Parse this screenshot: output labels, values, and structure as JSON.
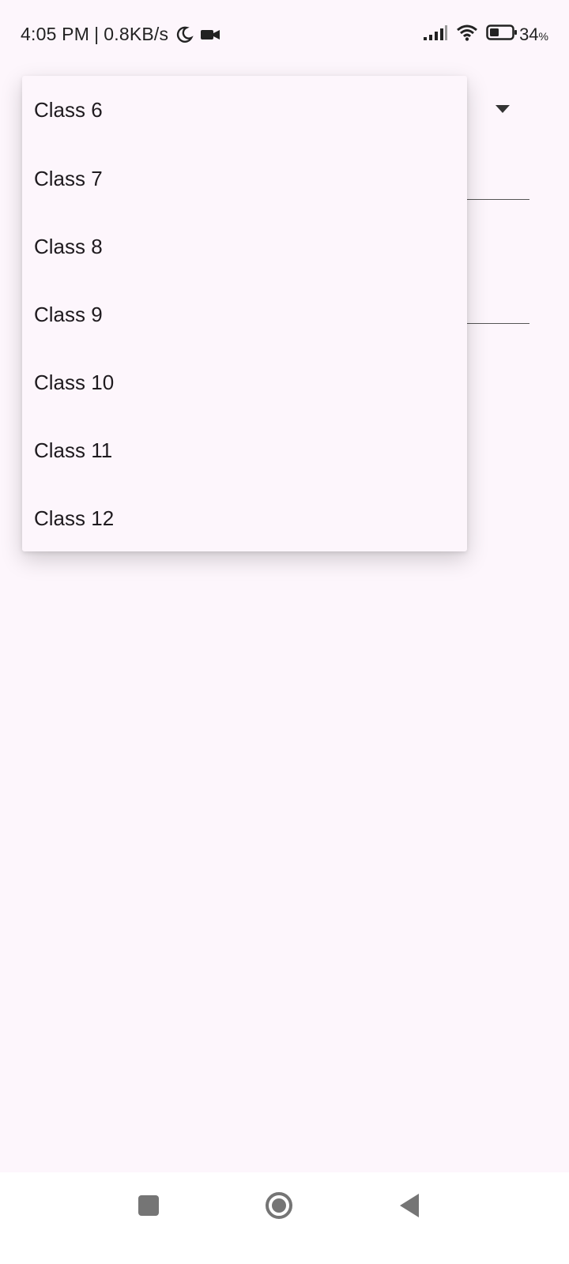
{
  "status_bar": {
    "time": "4:05 PM",
    "separator": "|",
    "network_speed": "0.8KB/s",
    "battery_level": "34",
    "battery_unit": "%",
    "icons": [
      "moon-icon",
      "video-camera-icon",
      "signal-icon",
      "wifi-icon",
      "battery-icon"
    ]
  },
  "dropdown": {
    "options": [
      {
        "label": "Class 6"
      },
      {
        "label": "Class 7"
      },
      {
        "label": "Class 8"
      },
      {
        "label": "Class 9"
      },
      {
        "label": "Class 10"
      },
      {
        "label": "Class 11"
      },
      {
        "label": "Class 12"
      }
    ]
  },
  "nav_bar": {
    "icons": [
      "recent-apps-icon",
      "home-icon",
      "back-icon"
    ]
  },
  "colors": {
    "background": "#fdf6fc",
    "text": "#1f1b1f",
    "nav_icon": "#757575"
  }
}
